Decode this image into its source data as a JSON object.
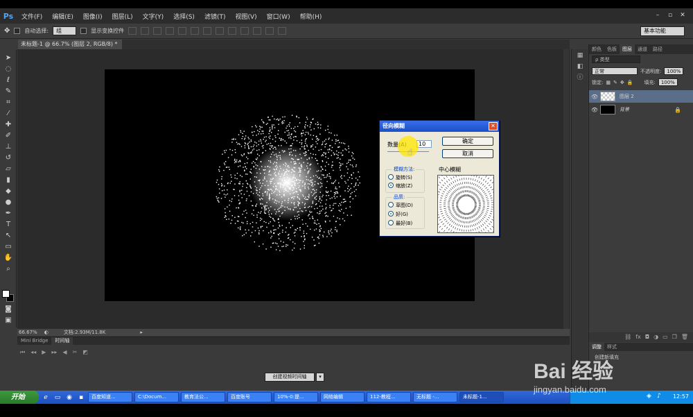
{
  "app": {
    "logo": "Ps",
    "menu": [
      "文件(F)",
      "编辑(E)",
      "图像(I)",
      "图层(L)",
      "文字(Y)",
      "选择(S)",
      "滤镜(T)",
      "视图(V)",
      "窗口(W)",
      "帮助(H)"
    ],
    "window_controls": [
      "–",
      "▫",
      "✕"
    ]
  },
  "options_bar": {
    "auto_select_label": "自动选择:",
    "auto_select_value": "组",
    "show_transform_label": "显示变换控件",
    "workspace": "基本功能"
  },
  "document": {
    "tab_title": "未标题-1 @ 66.7% (图层 2, RGB/8) *",
    "tab_close": "×",
    "zoom": "66.67%",
    "doc_info": "文档:2.93M/11.8K"
  },
  "timeline": {
    "tabs": [
      "Mini Bridge",
      "时间轴"
    ],
    "create_button": "创建视频时间轴",
    "create_arrow": "▾"
  },
  "panels": {
    "tabs": [
      "颜色",
      "色板",
      "图层",
      "通道",
      "路径"
    ],
    "active_tab": "图层",
    "filter_label": "ρ 类型",
    "blend_mode": "正常",
    "opacity_label": "不透明度:",
    "opacity_value": "100%",
    "lock_label": "锁定:",
    "fill_label": "填充:",
    "fill_value": "100%",
    "layers": [
      {
        "name": "图层 2",
        "selected": true
      },
      {
        "name": "背景",
        "selected": false
      }
    ],
    "bottom_tabs": [
      "调整",
      "样式"
    ],
    "history_item": "创建新填充"
  },
  "dialog": {
    "title": "径向模糊",
    "close": "✕",
    "amount_label": "数量(A)",
    "amount_value": "10",
    "ok_button": "确定",
    "cancel_button": "取消",
    "blur_method_title": "模糊方法:",
    "blur_methods": [
      {
        "label": "旋转(S)",
        "selected": false
      },
      {
        "label": "缩放(Z)",
        "selected": true
      }
    ],
    "quality_title": "品质:",
    "qualities": [
      {
        "label": "草图(D)",
        "selected": false
      },
      {
        "label": "好(G)",
        "selected": true
      },
      {
        "label": "最好(B)",
        "selected": false
      }
    ],
    "center_label": "中心模糊"
  },
  "taskbar": {
    "start": "开始",
    "tasks": [
      "百度知道...",
      "C:\\Docum...",
      "教育法公...",
      "百度账号",
      "10%-0:提...",
      "网络编辑",
      "112-教程...",
      "无标题 -...",
      "未标题-1..."
    ],
    "time": "12:57"
  },
  "watermark": {
    "logo": "Bai 经验",
    "url": "jingyan.baidu.com"
  },
  "colors": {
    "accent": "#4da6ff",
    "dialog_bg": "#ece9d8",
    "taskbar": "#245edb",
    "selected_layer": "#5a6e8a"
  }
}
